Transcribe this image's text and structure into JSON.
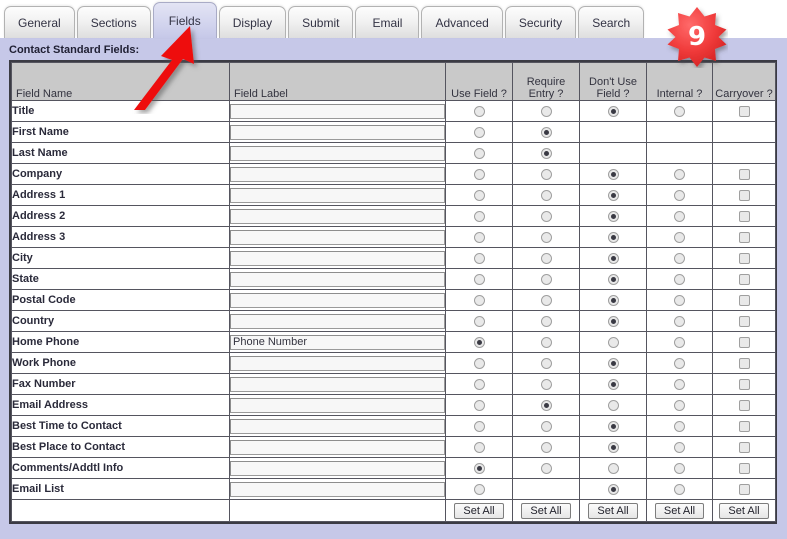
{
  "tabs": [
    {
      "label": "General",
      "active": false
    },
    {
      "label": "Sections",
      "active": false
    },
    {
      "label": "Fields",
      "active": true
    },
    {
      "label": "Display",
      "active": false
    },
    {
      "label": "Submit",
      "active": false
    },
    {
      "label": "Email",
      "active": false
    },
    {
      "label": "Advanced",
      "active": false
    },
    {
      "label": "Security",
      "active": false
    },
    {
      "label": "Search",
      "active": false
    }
  ],
  "section": {
    "title": "Contact Standard Fields:"
  },
  "table": {
    "headers": [
      "Field Name",
      "Field Label",
      "Use Field ?",
      "Require Entry ?",
      "Don't Use Field ?",
      "Internal ?",
      "Carryover ?"
    ],
    "rows": [
      {
        "name": "Title",
        "label": "",
        "placeholder": "",
        "use": false,
        "require": false,
        "dontuse": true,
        "internal": false,
        "carryover": false,
        "cells": [
          "radio",
          "radio",
          "radio",
          "radio",
          "check"
        ]
      },
      {
        "name": "First Name",
        "label": "",
        "placeholder": "",
        "use": false,
        "require": true,
        "dontuse": false,
        "internal": false,
        "carryover": false,
        "cells": [
          "radio",
          "radio",
          "none",
          "none",
          "none"
        ]
      },
      {
        "name": "Last Name",
        "label": "",
        "placeholder": "",
        "use": false,
        "require": true,
        "dontuse": false,
        "internal": false,
        "carryover": false,
        "cells": [
          "radio",
          "radio",
          "none",
          "none",
          "none"
        ]
      },
      {
        "name": "Company",
        "label": "",
        "placeholder": "",
        "use": false,
        "require": false,
        "dontuse": true,
        "internal": false,
        "carryover": false,
        "cells": [
          "radio",
          "radio",
          "radio",
          "radio",
          "check"
        ]
      },
      {
        "name": "Address 1",
        "label": "",
        "placeholder": "",
        "use": false,
        "require": false,
        "dontuse": true,
        "internal": false,
        "carryover": false,
        "cells": [
          "radio",
          "radio",
          "radio",
          "radio",
          "check"
        ]
      },
      {
        "name": "Address 2",
        "label": "",
        "placeholder": "",
        "use": false,
        "require": false,
        "dontuse": true,
        "internal": false,
        "carryover": false,
        "cells": [
          "radio",
          "radio",
          "radio",
          "radio",
          "check"
        ]
      },
      {
        "name": "Address 3",
        "label": "",
        "placeholder": "",
        "use": false,
        "require": false,
        "dontuse": true,
        "internal": false,
        "carryover": false,
        "cells": [
          "radio",
          "radio",
          "radio",
          "radio",
          "check"
        ]
      },
      {
        "name": "City",
        "label": "",
        "placeholder": "",
        "use": false,
        "require": false,
        "dontuse": true,
        "internal": false,
        "carryover": false,
        "cells": [
          "radio",
          "radio",
          "radio",
          "radio",
          "check"
        ]
      },
      {
        "name": "State",
        "label": "",
        "placeholder": "",
        "use": false,
        "require": false,
        "dontuse": true,
        "internal": false,
        "carryover": false,
        "cells": [
          "radio",
          "radio",
          "radio",
          "radio",
          "check"
        ]
      },
      {
        "name": "Postal Code",
        "label": "",
        "placeholder": "",
        "use": false,
        "require": false,
        "dontuse": true,
        "internal": false,
        "carryover": false,
        "cells": [
          "radio",
          "radio",
          "radio",
          "radio",
          "check"
        ]
      },
      {
        "name": "Country",
        "label": "",
        "placeholder": "",
        "use": false,
        "require": false,
        "dontuse": true,
        "internal": false,
        "carryover": false,
        "cells": [
          "radio",
          "radio",
          "radio",
          "radio",
          "check"
        ]
      },
      {
        "name": "Home Phone",
        "label": "Phone Number",
        "placeholder": "",
        "use": true,
        "require": false,
        "dontuse": false,
        "internal": false,
        "carryover": false,
        "cells": [
          "radio",
          "radio",
          "radio",
          "radio",
          "check"
        ]
      },
      {
        "name": "Work Phone",
        "label": "",
        "placeholder": "",
        "use": false,
        "require": false,
        "dontuse": true,
        "internal": false,
        "carryover": false,
        "cells": [
          "radio",
          "radio",
          "radio",
          "radio",
          "check"
        ]
      },
      {
        "name": "Fax Number",
        "label": "",
        "placeholder": "",
        "use": false,
        "require": false,
        "dontuse": true,
        "internal": false,
        "carryover": false,
        "cells": [
          "radio",
          "radio",
          "radio",
          "radio",
          "check"
        ]
      },
      {
        "name": "Email Address",
        "label": "",
        "placeholder": "",
        "use": false,
        "require": true,
        "dontuse": false,
        "internal": false,
        "carryover": false,
        "cells": [
          "radio",
          "radio",
          "radio",
          "radio",
          "check"
        ]
      },
      {
        "name": "Best Time to Contact",
        "label": "",
        "placeholder": "",
        "use": false,
        "require": false,
        "dontuse": true,
        "internal": false,
        "carryover": false,
        "cells": [
          "radio",
          "radio",
          "radio",
          "radio",
          "check"
        ]
      },
      {
        "name": "Best Place to Contact",
        "label": "",
        "placeholder": "",
        "use": false,
        "require": false,
        "dontuse": true,
        "internal": false,
        "carryover": false,
        "cells": [
          "radio",
          "radio",
          "radio",
          "radio",
          "check"
        ]
      },
      {
        "name": "Comments/Addtl Info",
        "label": "",
        "placeholder": "",
        "use": true,
        "require": false,
        "dontuse": false,
        "internal": false,
        "carryover": false,
        "cells": [
          "radio",
          "radio",
          "radio",
          "radio",
          "check"
        ]
      },
      {
        "name": "Email List",
        "label": "",
        "placeholder": "",
        "use": false,
        "require": false,
        "dontuse": true,
        "internal": false,
        "carryover": false,
        "cells": [
          "radio",
          "none",
          "radio",
          "radio",
          "check"
        ]
      }
    ],
    "footer": {
      "set_all_label": "Set All",
      "set_all_count": 5
    }
  },
  "annotations": {
    "badge": {
      "number": "9",
      "color": "#ee3b3b"
    },
    "arrow": {
      "color": "#ee1111",
      "points_to": "Fields"
    }
  }
}
